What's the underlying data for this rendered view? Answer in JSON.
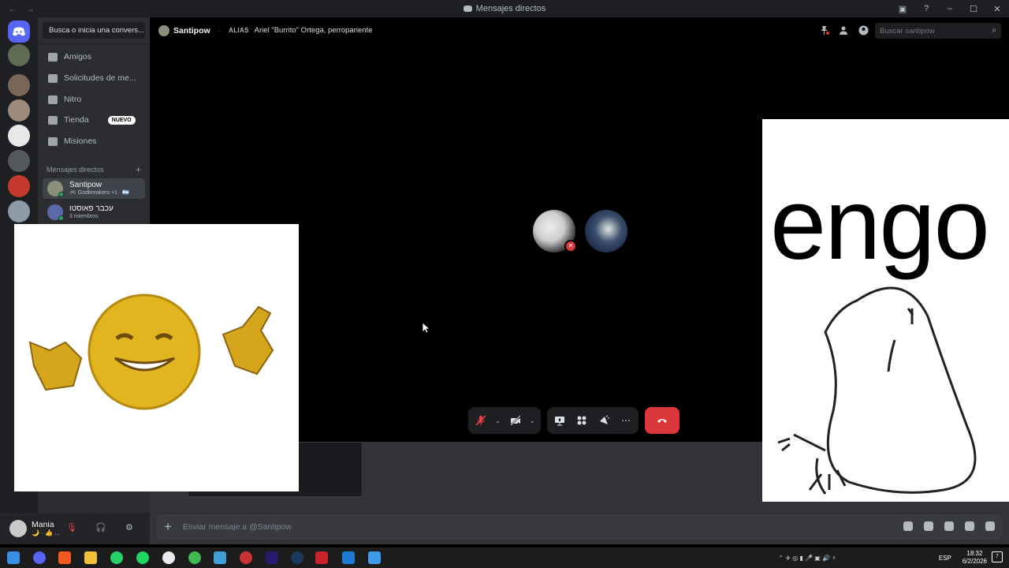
{
  "window": {
    "title": "Mensajes directos"
  },
  "sidebar": {
    "search_label": "Busca o inicia una convers...",
    "nav": [
      {
        "label": "Amigos",
        "icon": "friends-icon"
      },
      {
        "label": "Solicitudes de me...",
        "icon": "message-requests-icon"
      },
      {
        "label": "Nitro",
        "icon": "nitro-icon"
      },
      {
        "label": "Tienda",
        "icon": "shop-icon",
        "badge": "NUEVO"
      },
      {
        "label": "Misiones",
        "icon": "quests-icon"
      }
    ],
    "dm_header": "Mensajes directos",
    "dms": [
      {
        "name": "Santipow",
        "sub": "🎮 Godbreakers +1 · 🇦🇷"
      },
      {
        "name": "עכבר פאוסטו",
        "sub": "3 miembros"
      }
    ]
  },
  "user": {
    "name": "Mania",
    "status": "🌙 · 👍 ..."
  },
  "header": {
    "name": "Santipow",
    "alias_label": "ALIAS",
    "alias_value": "Ariel \"Burrito\" Ortega, perropariente",
    "search_placeholder": "Buscar santipow"
  },
  "composer": {
    "placeholder": "Enviar mensaje a @Santipow"
  },
  "overlay": {
    "text": "engo"
  },
  "taskbar": {
    "lang": "ESP",
    "time": "18:32",
    "date": "6/2/2026",
    "notifications": "7"
  },
  "colors": {
    "accent": "#5865f2",
    "danger": "#da373c",
    "online": "#23a55a"
  }
}
